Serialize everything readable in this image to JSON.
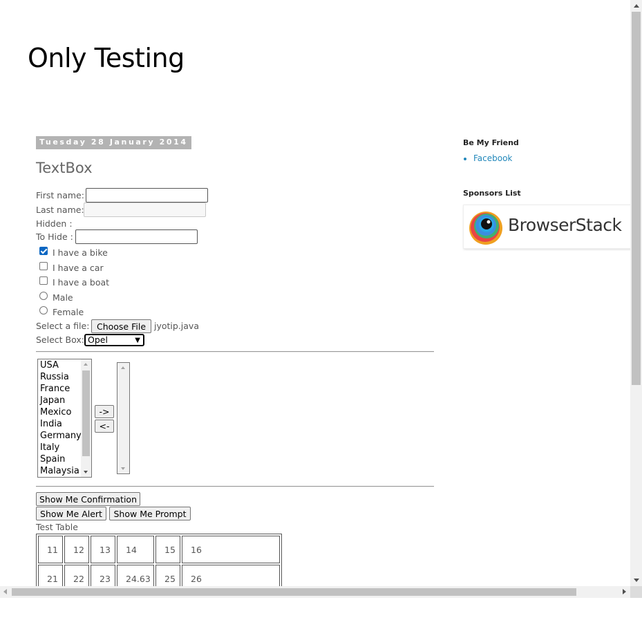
{
  "blog": {
    "title": "Only Testing"
  },
  "post": {
    "date": "Tuesday 28 January 2014",
    "title": "TextBox"
  },
  "form": {
    "first_name_label": "First name:",
    "first_name_value": "",
    "last_name_label": "Last name:",
    "last_name_value": "",
    "hidden_label": "Hidden :",
    "to_hide_label": "To Hide :",
    "to_hide_value": "",
    "checkboxes": [
      {
        "label": "I have a bike",
        "checked": true
      },
      {
        "label": "I have a car",
        "checked": false
      },
      {
        "label": "I have a boat",
        "checked": false
      }
    ],
    "radios": [
      {
        "label": "Male",
        "selected": false
      },
      {
        "label": "Female",
        "selected": false
      }
    ],
    "file_label": "Select a file:",
    "file_button": "Choose File",
    "file_name": "jyotip.java",
    "select_label": "Select Box:",
    "select_value": "Opel"
  },
  "transfer": {
    "left_items": [
      "USA",
      "Russia",
      "France",
      "Japan",
      "Mexico",
      "India",
      "Germany",
      "Italy",
      "Spain",
      "Malaysia"
    ],
    "right_items": [],
    "move_right_label": "->",
    "move_left_label": "<-"
  },
  "buttons": {
    "confirmation": "Show Me Confirmation",
    "alert": "Show Me Alert",
    "prompt": "Show Me Prompt"
  },
  "table": {
    "caption": "Test Table",
    "rows": [
      [
        "11",
        "12",
        "13",
        "14",
        "15",
        "16"
      ],
      [
        "21",
        "22",
        "23",
        "24.63",
        "25",
        "26"
      ]
    ]
  },
  "sidebar": {
    "friend_title": "Be My Friend",
    "links": [
      "Facebook"
    ],
    "sponsors_title": "Sponsors List",
    "sponsor_name": "BrowserStack"
  }
}
